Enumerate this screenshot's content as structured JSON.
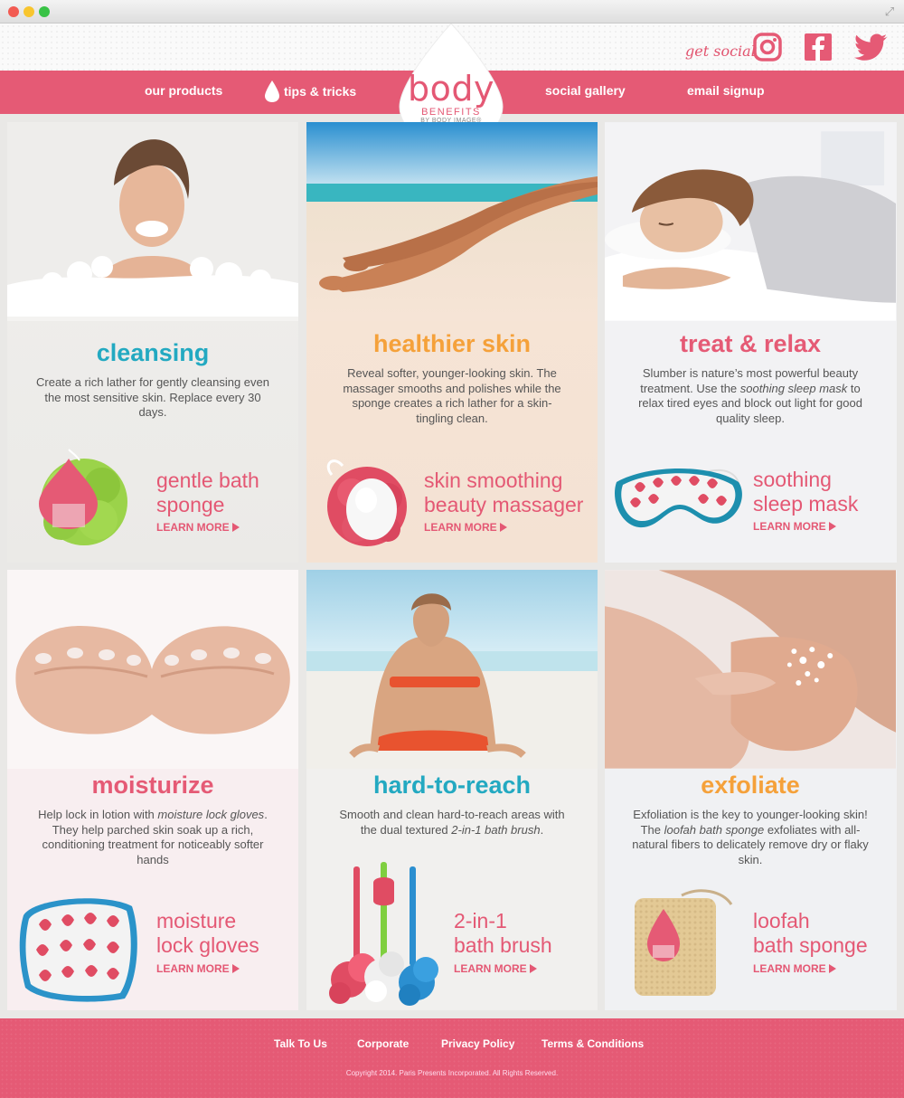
{
  "header": {
    "get_social": "get social",
    "social_icons": [
      "instagram-icon",
      "facebook-icon",
      "twitter-icon"
    ]
  },
  "nav": {
    "items": [
      "our products",
      "tips & tricks",
      "social gallery",
      "email signup"
    ]
  },
  "logo": {
    "word": "body",
    "benefits": "BENEFITS",
    "by": "BY BODY IMAGE®",
    "dots": "•••"
  },
  "colors": {
    "brand_pink": "#e55a75",
    "teal": "#23a9c1",
    "orange": "#f5a13a"
  },
  "cards": [
    {
      "heading": "cleansing",
      "heading_color": "#23a9c1",
      "description": "Create a rich lather for gently cleansing even the most sensitive skin. Replace every 30 days.",
      "product_line1": "gentle bath",
      "product_line2": "sponge",
      "learn_more": "LEARN MORE"
    },
    {
      "heading": "healthier skin",
      "heading_color": "#f5a13a",
      "description": "Reveal softer, younger-looking skin. The massager smooths and polishes while the sponge creates a rich lather for a skin-tingling clean.",
      "product_line1": "skin smoothing",
      "product_line2": "beauty massager",
      "learn_more": "LEARN MORE"
    },
    {
      "heading": "treat & relax",
      "heading_color": "#e55a75",
      "description_parts": [
        "Slumber is nature’s most powerful beauty treatment. Use the ",
        "soothing sleep mask",
        " to relax tired eyes and block out light for good quality sleep."
      ],
      "product_line1": "soothing",
      "product_line2": "sleep mask",
      "learn_more": "LEARN MORE"
    },
    {
      "heading": "moisturize",
      "heading_color": "#e55a75",
      "description_parts": [
        "Help lock in lotion with ",
        "moisture lock gloves",
        ". They help parched skin soak up a rich, conditioning treatment for noticeably softer hands"
      ],
      "product_line1": "moisture",
      "product_line2": "lock gloves",
      "learn_more": "LEARN MORE"
    },
    {
      "heading": "hard-to-reach",
      "heading_color": "#23a9c1",
      "description_parts": [
        "Smooth and clean hard-to-reach areas with the dual textured ",
        "2-in-1 bath brush",
        "."
      ],
      "product_line1": "2-in-1",
      "product_line2": "bath brush",
      "learn_more": "LEARN MORE"
    },
    {
      "heading": "exfoliate",
      "heading_color": "#f5a13a",
      "description_parts": [
        "Exfoliation is the key to younger-looking skin! The ",
        "loofah bath sponge",
        " exfoliates with all-natural fibers to delicately remove dry or flaky skin."
      ],
      "product_line1": "loofah",
      "product_line2": "bath sponge",
      "learn_more": "LEARN MORE"
    }
  ],
  "footer": {
    "links": [
      "Talk To Us",
      "Corporate",
      "Privacy Policy",
      "Terms & Conditions"
    ],
    "copyright": "Copyright 2014. Paris Presents Incorporated. All Rights Reserved."
  }
}
